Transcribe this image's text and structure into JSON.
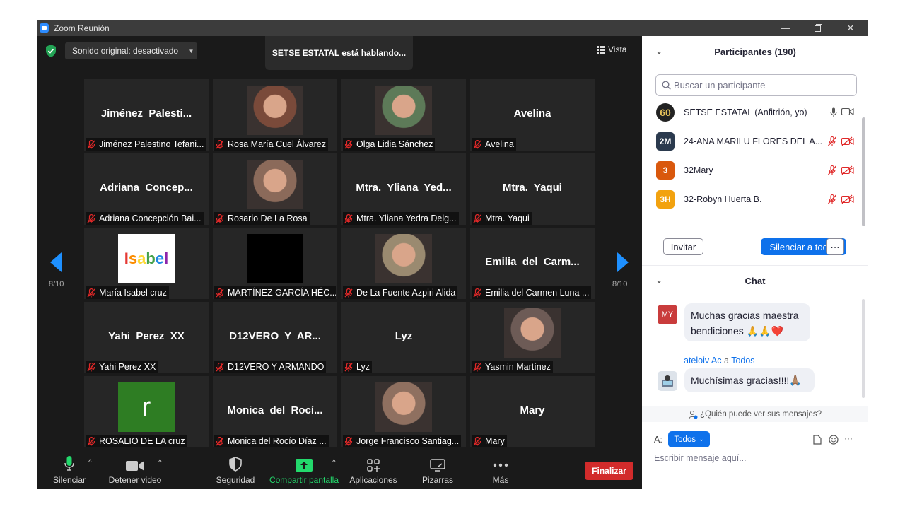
{
  "window": {
    "title": "Zoom Reunión"
  },
  "header": {
    "audio_label": "Sonido original: desactivado",
    "speaking": "SETSE ESTATAL está hablando...",
    "view_label": "Vista"
  },
  "gallery": {
    "page_left": "8/10",
    "page_right": "8/10",
    "tiles": [
      {
        "big": "Jiménez  Palesti...",
        "label": "Jiménez Palestino Tefani..."
      },
      {
        "big": "",
        "label": "Rosa María Cuel Álvarez"
      },
      {
        "big": "",
        "label": "Olga Lidia Sánchez"
      },
      {
        "big": "Avelina",
        "label": "Avelina"
      },
      {
        "big": "Adriana  Concep...",
        "label": "Adriana Concepción Bai..."
      },
      {
        "big": "",
        "label": "Rosario De La Rosa"
      },
      {
        "big": "Mtra.  Yliana  Yed...",
        "label": "Mtra. Yliana Yedra Delg..."
      },
      {
        "big": "Mtra.  Yaqui",
        "label": "Mtra. Yaqui"
      },
      {
        "big": "",
        "label": "María Isabel cruz",
        "logo": "Isabel"
      },
      {
        "big": "",
        "label": "MARTÍNEZ GARCÍA HÉC..."
      },
      {
        "big": "",
        "label": "De La Fuente Azpiri Alida"
      },
      {
        "big": "Emilia  del  Carm...",
        "label": "Emilia del Carmen Luna ..."
      },
      {
        "big": "Yahi  Perez  XX",
        "label": "Yahi Perez XX"
      },
      {
        "big": "D12VERO  Y  AR...",
        "label": "D12VERO Y ARMANDO"
      },
      {
        "big": "Lyz",
        "label": "Lyz"
      },
      {
        "big": "",
        "label": "Yasmin Martínez"
      },
      {
        "big": "",
        "label": "ROSALIO DE LA cruz",
        "letter": "r"
      },
      {
        "big": "Monica  del  Rocí...",
        "label": "Monica del Rocío Díaz ..."
      },
      {
        "big": "",
        "label": "Jorge Francisco Santiag..."
      },
      {
        "big": "Mary",
        "label": "Mary"
      }
    ]
  },
  "toolbar": {
    "mute": "Silenciar",
    "video": "Detener video",
    "security": "Seguridad",
    "share": "Compartir pantalla",
    "apps": "Aplicaciones",
    "whiteboards": "Pizarras",
    "more": "Más",
    "end": "Finalizar"
  },
  "participants": {
    "title": "Participantes (190)",
    "search_placeholder": "Buscar un participante",
    "list": [
      {
        "avatar": "60",
        "name": "SETSE ESTATAL (Anfitrión, yo)",
        "color": "#222222"
      },
      {
        "avatar": "2M",
        "name": "24-ANA MARILU FLORES DEL A...",
        "color": "#2b3a4e"
      },
      {
        "avatar": "3",
        "name": "32Mary",
        "color": "#d9580d"
      },
      {
        "avatar": "3H",
        "name": "32-Robyn Huerta B.",
        "color": "#f2a20f"
      }
    ],
    "invite": "Invitar",
    "mute_all": "Silenciar a todos",
    "more": "···"
  },
  "chat": {
    "title": "Chat",
    "messages": [
      {
        "avatar": "MY",
        "avatar_color": "#c93c3c",
        "text_line1": "Muchas gracias maestra",
        "text_line2": "bendiciones 🙏🙏❤️"
      },
      {
        "sender": "ateloiv Ac",
        "to_word": " a ",
        "to": "Todos",
        "text": "Muchísimas gracias!!!!🙏🏽"
      }
    ],
    "who_can_see": "¿Quién puede ver sus mensajes?",
    "to_label": "A:",
    "to_value": "Todos",
    "input_placeholder": "Escribir mensaje aquí...",
    "more": "···"
  }
}
